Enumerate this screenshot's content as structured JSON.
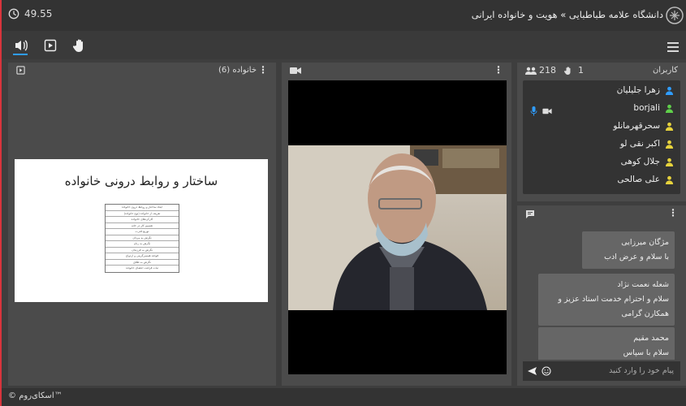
{
  "topbar": {
    "timer": "49.55",
    "title": "دانشگاه علامه طباطبایی » هویت و خانواده ایرانی"
  },
  "doc_panel": {
    "title": "خانواده (6)",
    "slide_title": "ساختار و روابط درونی خانواده",
    "slide_rows": [
      "ابعاد ساختار و روابط درون خانواده",
      "تعریف از خانواده (نوع خانواده)",
      "کارکردهای خانواده",
      "تقسیم کار در خانه",
      "توزیع قدرت",
      "نگرش به مردان",
      "نگرش به زنان",
      "نگرش به فرزندان",
      "قواعد همسرگزینی و ازدواج",
      "نگرش به طلاق",
      "ثبات فراغت اعضای خانواده"
    ]
  },
  "users_panel": {
    "title": "کاربران",
    "count": "218",
    "hand_count": "1",
    "users": [
      "زهرا جلیلیان",
      "borjali",
      "سحرقهرمانلو",
      "اکبر نقی لو",
      "جلال کوهی",
      "علی صالحی"
    ]
  },
  "chat": {
    "messages": [
      {
        "name": "مژگان میرزایی",
        "text": "با سلام و عرض ادب"
      },
      {
        "name": "شعله نعمت نژاد",
        "text": "سلام و احترام خدمت استاد عزیز و همکارن گرامی"
      },
      {
        "name": "محمد مقیم",
        "text": "سلام با سپاس محمدمقیم.مرکزتخصصی"
      }
    ],
    "placeholder": "پیام خود را وارد کنید"
  },
  "footer": {
    "brand": "© اسکای‌روم™"
  },
  "colors": {
    "accent": "#2f9dff",
    "user_icon_yellow": "#e6d23c",
    "user_icon_blue": "#2f9dff",
    "user_icon_green": "#5fd04a",
    "left_border": "#d8343c"
  }
}
